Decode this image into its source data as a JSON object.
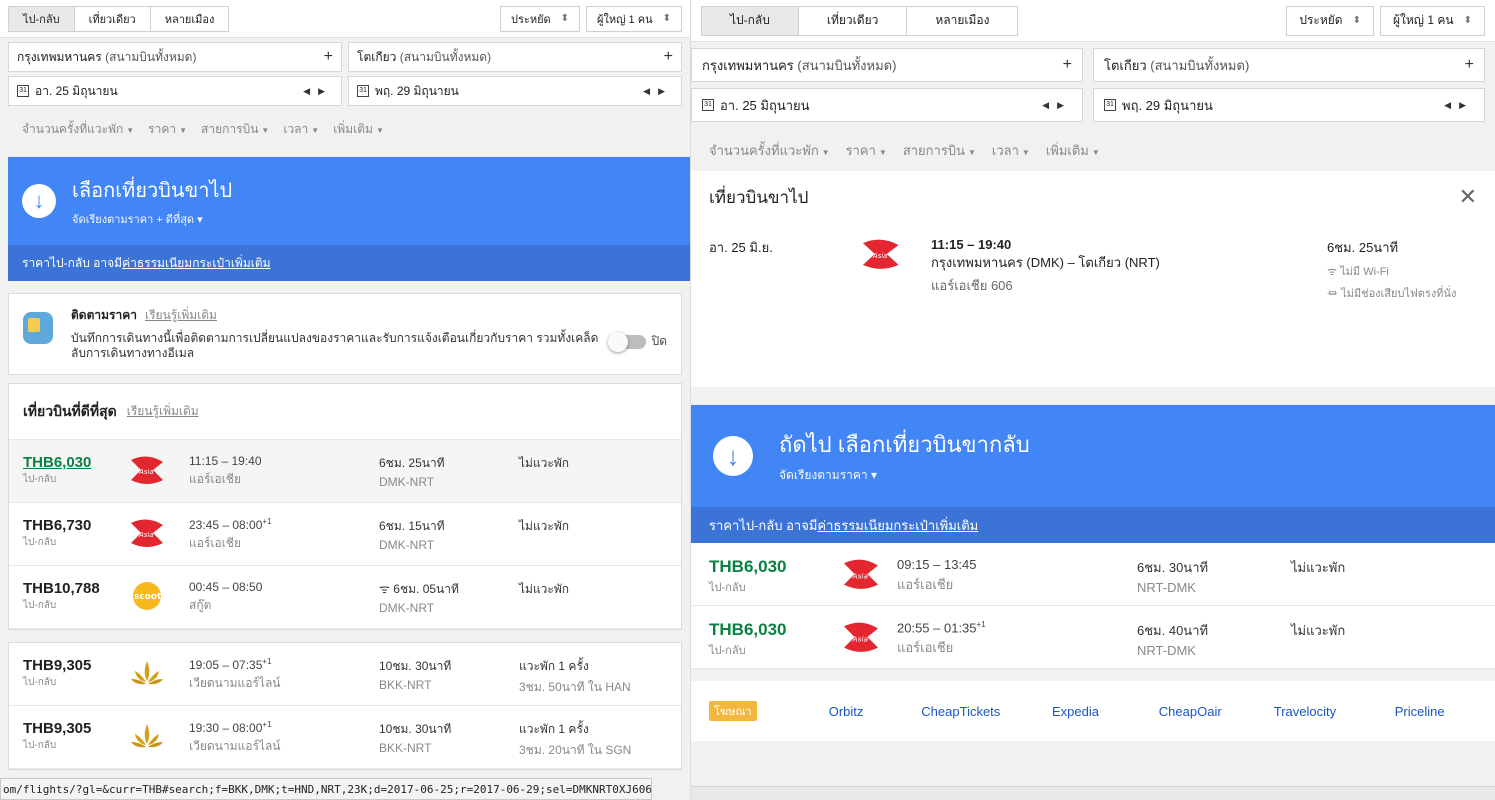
{
  "trip_tabs": [
    "ไป-กลับ",
    "เที่ยวเดียว",
    "หลายเมือง"
  ],
  "cabin": "ประหยัด",
  "passengers": "ผู้ใหญ่ 1 คน",
  "origin": {
    "city": "กรุงเทพมหานคร",
    "sub": "(สนามบินทั้งหมด)",
    "plus": "+"
  },
  "destination": {
    "city": "โตเกียว",
    "sub": "(สนามบินทั้งหมด)",
    "plus": "+"
  },
  "depart_date": "อา. 25 มิถุนายน",
  "return_date": "พฤ. 29 มิถุนายน",
  "calendar_glyph": "31",
  "filters": [
    "จำนวนครั้งที่แวะพัก",
    "ราคา",
    "สายการบิน",
    "เวลา",
    "เพิ่มเติม"
  ],
  "left": {
    "header_title": "เลือกเที่ยวบินขาไป",
    "header_sort": "จัดเรียงตามราคา + ดีที่สุด",
    "fee_prefix": "ราคาไป-กลับ อาจมี",
    "fee_link": "ค่าธรรมเนียมกระเป๋าเพิ่มเติม",
    "track": {
      "title": "ติดตามราคา",
      "link": "เรียนรู้เพิ่มเติม",
      "desc": "บันทึกการเดินทางนี้เพื่อติดตามการเปลี่ยนแปลงของราคาและรับการแจ้งเตือนเกี่ยวกับราคา รวมทั้งเคล็ดลับการเดินทางทางอีเมล",
      "toggle_label": "ปิด"
    },
    "best_title": "เที่ยวบินที่ดีที่สุด",
    "best_link": "เรียนรู้เพิ่มเติม",
    "best_flights": [
      {
        "price": "THB6,030",
        "ptype": "ไป-กลับ",
        "time": "11:15 – 19:40",
        "sup": "",
        "airline": "แอร์เอเชีย",
        "logo": "airasia",
        "wifi": "",
        "dur": "6ชม. 25นาที",
        "route": "DMK-NRT",
        "stops": "ไม่แวะพัก",
        "stops_detail": ""
      },
      {
        "price": "THB6,730",
        "ptype": "ไป-กลับ",
        "time": "23:45 – 08:00",
        "sup": "+1",
        "airline": "แอร์เอเชีย",
        "logo": "airasia",
        "wifi": "",
        "dur": "6ชม. 15นาที",
        "route": "DMK-NRT",
        "stops": "ไม่แวะพัก",
        "stops_detail": ""
      },
      {
        "price": "THB10,788",
        "ptype": "ไป-กลับ",
        "time": "00:45 – 08:50",
        "sup": "",
        "airline": "สกู๊ต",
        "logo": "scoot",
        "wifi": "ᯤ",
        "dur": "6ชม. 05นาที",
        "route": "DMK-NRT",
        "stops": "ไม่แวะพัก",
        "stops_detail": ""
      }
    ],
    "other_flights": [
      {
        "price": "THB9,305",
        "ptype": "ไป-กลับ",
        "time": "19:05 – 07:35",
        "sup": "+1",
        "airline": "เวียดนามแอร์ไลน์",
        "logo": "vietnam",
        "wifi": "",
        "dur": "10ชม. 30นาที",
        "route": "BKK-NRT",
        "stops": "แวะพัก 1 ครั้ง",
        "stops_detail": "3ชม. 50นาที ใน HAN"
      },
      {
        "price": "THB9,305",
        "ptype": "ไป-กลับ",
        "time": "19:30 – 08:00",
        "sup": "+1",
        "airline": "เวียดนามแอร์ไลน์",
        "logo": "vietnam",
        "wifi": "",
        "dur": "10ชม. 30นาที",
        "route": "BKK-NRT",
        "stops": "แวะพัก 1 ครั้ง",
        "stops_detail": "3ชม. 20นาที ใน SGN"
      }
    ],
    "status_url": "om/flights/?gl=&curr=THB#search;f=BKK,DMK;t=HND,NRT,23K;d=2017-06-25;r=2017-06-29;sel=DMKNRT0XJ606"
  },
  "right": {
    "selected_title": "เที่ยวบินขาไป",
    "close": "✕",
    "selected": {
      "date": "อา. 25 มิ.ย.",
      "time": "11:15 – 19:40",
      "route": "กรุงเทพมหานคร (DMK) – โตเกียว (NRT)",
      "flight": "แอร์เอเชีย 606",
      "duration": "6ชม. 25นาที",
      "amenity1": "ไม่มี Wi-Fi",
      "amenity2": "ไม่มีช่องเสียบไฟตรงที่นั่ง"
    },
    "header_title": "ถัดไป เลือกเที่ยวบินขากลับ",
    "header_sort": "จัดเรียงตามราคา",
    "fee_prefix": "ราคาไป-กลับ อาจมี",
    "fee_link": "ค่าธรรมเนียมกระเป๋าเพิ่มเติม",
    "flights": [
      {
        "price": "THB6,030",
        "ptype": "ไป-กลับ",
        "time": "09:15 – 13:45",
        "sup": "",
        "airline": "แอร์เอเชีย",
        "dur": "6ชม. 30นาที",
        "route": "NRT-DMK",
        "stops": "ไม่แวะพัก"
      },
      {
        "price": "THB6,030",
        "ptype": "ไป-กลับ",
        "time": "20:55 – 01:35",
        "sup": "+1",
        "airline": "แอร์เอเชีย",
        "dur": "6ชม. 40นาที",
        "route": "NRT-DMK",
        "stops": "ไม่แวะพัก"
      }
    ],
    "ota_tag": "โฆษณา",
    "otas": [
      "Orbitz",
      "CheapTickets",
      "Expedia",
      "CheapOair",
      "Travelocity",
      "Priceline"
    ]
  },
  "colors": {
    "blue": "#4285f4",
    "bluebar": "#3b74d6",
    "green": "#0b8043",
    "airasia_red": "#e3262f"
  },
  "icons": {
    "down_arrow": "arrow-down-icon",
    "close": "close-icon",
    "wifi": "wifi-icon",
    "plug": "plug-icon",
    "calendar": "calendar-icon"
  }
}
